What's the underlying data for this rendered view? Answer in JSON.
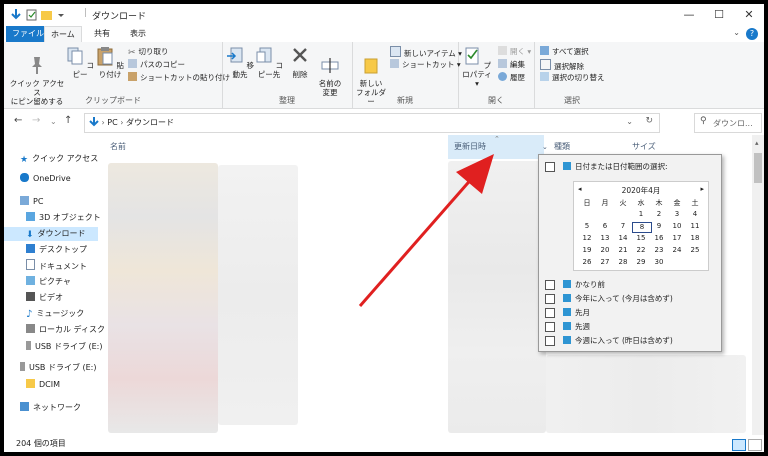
{
  "window": {
    "title": "ダウンロード",
    "controls": [
      "—",
      "☐",
      "✕"
    ]
  },
  "ribbon_tabs": [
    "ファイル",
    "ホーム",
    "共有",
    "表示"
  ],
  "ribbon": {
    "clipboard": {
      "group_label": "クリップボード",
      "pin_label": "クイック アクセス\nにピン留めする",
      "copy_label": "コピー",
      "paste_label": "貼り付け",
      "cut_label": "切り取り",
      "copy_path_label": "パスのコピー",
      "paste_shortcut_label": "ショートカットの貼り付け"
    },
    "organize": {
      "group_label": "整理",
      "move_label": "移動先",
      "copyto_label": "コピー先",
      "delete_label": "削除",
      "rename_label": "名前の\n変更"
    },
    "new": {
      "group_label": "新規",
      "newfolder_label": "新しい\nフォルダー",
      "newitem_label": "新しいアイテム",
      "shortcut_label": "ショートカット"
    },
    "open": {
      "group_label": "開く",
      "properties_label": "プロパティ",
      "open_label": "開く",
      "edit_label": "編集",
      "history_label": "履歴"
    },
    "select": {
      "group_label": "選択",
      "selectall_label": "すべて選択",
      "selectnone_label": "選択解除",
      "invert_label": "選択の切り替え"
    }
  },
  "address": {
    "path": [
      "PC",
      "ダウンロード"
    ],
    "search_placeholder": "ダウンロ..."
  },
  "nav_items": [
    {
      "label": "クイック アクセス",
      "icon": "star-icon",
      "indent": 0
    },
    {
      "label": "OneDrive",
      "icon": "cloud-icon",
      "indent": 0
    },
    {
      "label": "PC",
      "icon": "pc-icon",
      "indent": 0
    },
    {
      "label": "3D オブジェクト",
      "icon": "cube-icon",
      "indent": 1
    },
    {
      "label": "ダウンロード",
      "icon": "download-icon",
      "indent": 1
    },
    {
      "label": "デスクトップ",
      "icon": "desktop-icon",
      "indent": 1
    },
    {
      "label": "ドキュメント",
      "icon": "document-icon",
      "indent": 1
    },
    {
      "label": "ピクチャ",
      "icon": "pictures-icon",
      "indent": 1
    },
    {
      "label": "ビデオ",
      "icon": "video-icon",
      "indent": 1
    },
    {
      "label": "ミュージック",
      "icon": "music-icon",
      "indent": 1
    },
    {
      "label": "ローカル ディスク (",
      "icon": "disk-icon",
      "indent": 1
    },
    {
      "label": "USB ドライブ (E:)",
      "icon": "usb-icon",
      "indent": 1
    },
    {
      "label": "USB ドライブ (E:)",
      "icon": "usb-icon",
      "indent": 0
    },
    {
      "label": "DCIM",
      "icon": "folder-icon",
      "indent": 1
    },
    {
      "label": "ネットワーク",
      "icon": "network-icon",
      "indent": 0
    }
  ],
  "columns": {
    "name": "名前",
    "date": "更新日時",
    "type": "種類",
    "size": "サイズ"
  },
  "date_filter": {
    "range_label": "日付または日付範囲の選択:",
    "calendar": {
      "month_label": "2020年4月",
      "weekdays": [
        "日",
        "月",
        "火",
        "水",
        "木",
        "金",
        "土"
      ],
      "weeks": [
        [
          "",
          "",
          "",
          "1",
          "2",
          "3",
          "4"
        ],
        [
          "5",
          "6",
          "7",
          "8",
          "9",
          "10",
          "11"
        ],
        [
          "12",
          "13",
          "14",
          "15",
          "16",
          "17",
          "18"
        ],
        [
          "19",
          "20",
          "21",
          "22",
          "23",
          "24",
          "25"
        ],
        [
          "26",
          "27",
          "28",
          "29",
          "30",
          "",
          ""
        ]
      ],
      "selected_day": "8"
    },
    "options": [
      "かなり前",
      "今年に入って (今月は含めず)",
      "先月",
      "先週",
      "今週に入って (昨日は含めず)"
    ]
  },
  "status": {
    "item_count": "204 個の項目"
  },
  "colors": {
    "accent": "#1979ca",
    "arrow": "#e02020",
    "selected_nav": "#cce8ff"
  }
}
